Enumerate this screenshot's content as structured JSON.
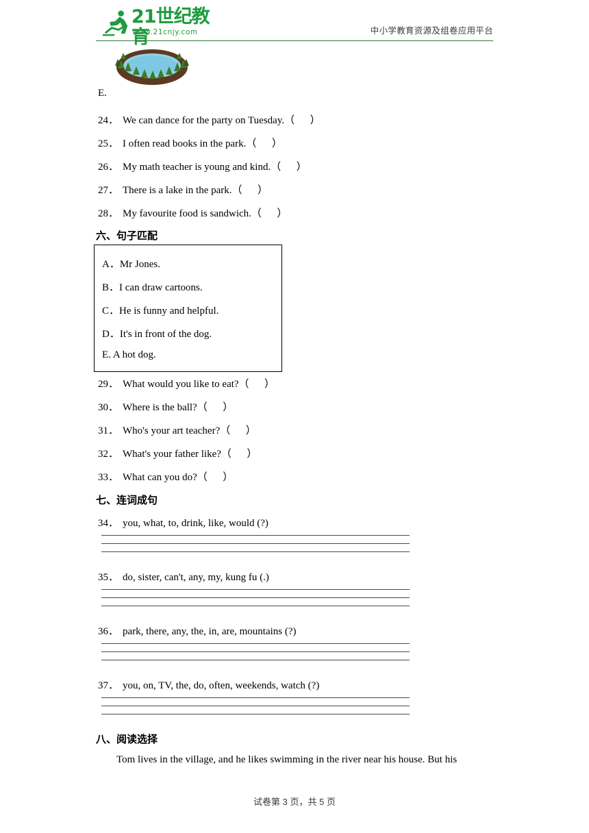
{
  "header": {
    "logo_text": "21世纪教育",
    "logo_sub": "www.21cnjy.com",
    "tagline": "中小学教育资源及组卷应用平台",
    "logo_color": "#1f9b3f"
  },
  "image_e": {
    "label": "E.",
    "alt": "pond-illustration"
  },
  "section_five_questions": [
    {
      "num": "24．",
      "text": "We can dance for the party on Tuesday.（      ）"
    },
    {
      "num": "25．",
      "text": "I often read books in the park.（      ）"
    },
    {
      "num": "26．",
      "text": "My math teacher is young and kind.（      ）"
    },
    {
      "num": "27．",
      "text": "There is a lake in the park.（      ）"
    },
    {
      "num": "28．",
      "text": "My favourite food is sandwich.（      ）"
    }
  ],
  "section_six": {
    "title": "六、句子匹配",
    "options": [
      "A．Mr Jones.",
      "B．I can draw cartoons.",
      "C．He is funny and helpful.",
      "D．It's in front of the dog.",
      "E. A hot dog."
    ],
    "questions": [
      {
        "num": "29．",
        "text": "What would you like to eat?（      ）"
      },
      {
        "num": "30．",
        "text": "Where is the ball?（      ）"
      },
      {
        "num": "31．",
        "text": "Who's your art teacher?（      ）"
      },
      {
        "num": "32．",
        "text": "What's your father like?（      ）"
      },
      {
        "num": "33．",
        "text": "What can you do?（      ）"
      }
    ]
  },
  "section_seven": {
    "title": "七、连词成句",
    "questions": [
      {
        "num": "34．",
        "text": "you, what, to, drink, like, would (?)"
      },
      {
        "num": "35．",
        "text": "do, sister, can't, any, my, kung fu (.)"
      },
      {
        "num": "36．",
        "text": "park, there, any, the, in, are, mountains (?)"
      },
      {
        "num": "37．",
        "text": "you, on, TV, the, do, often, weekends, watch (?)"
      }
    ]
  },
  "section_eight": {
    "title": "八、阅读选择",
    "passage": "Tom lives in the village, and he likes swimming in the river near his house. But his"
  },
  "footer": {
    "text": "试卷第 3 页，共 5 页"
  }
}
